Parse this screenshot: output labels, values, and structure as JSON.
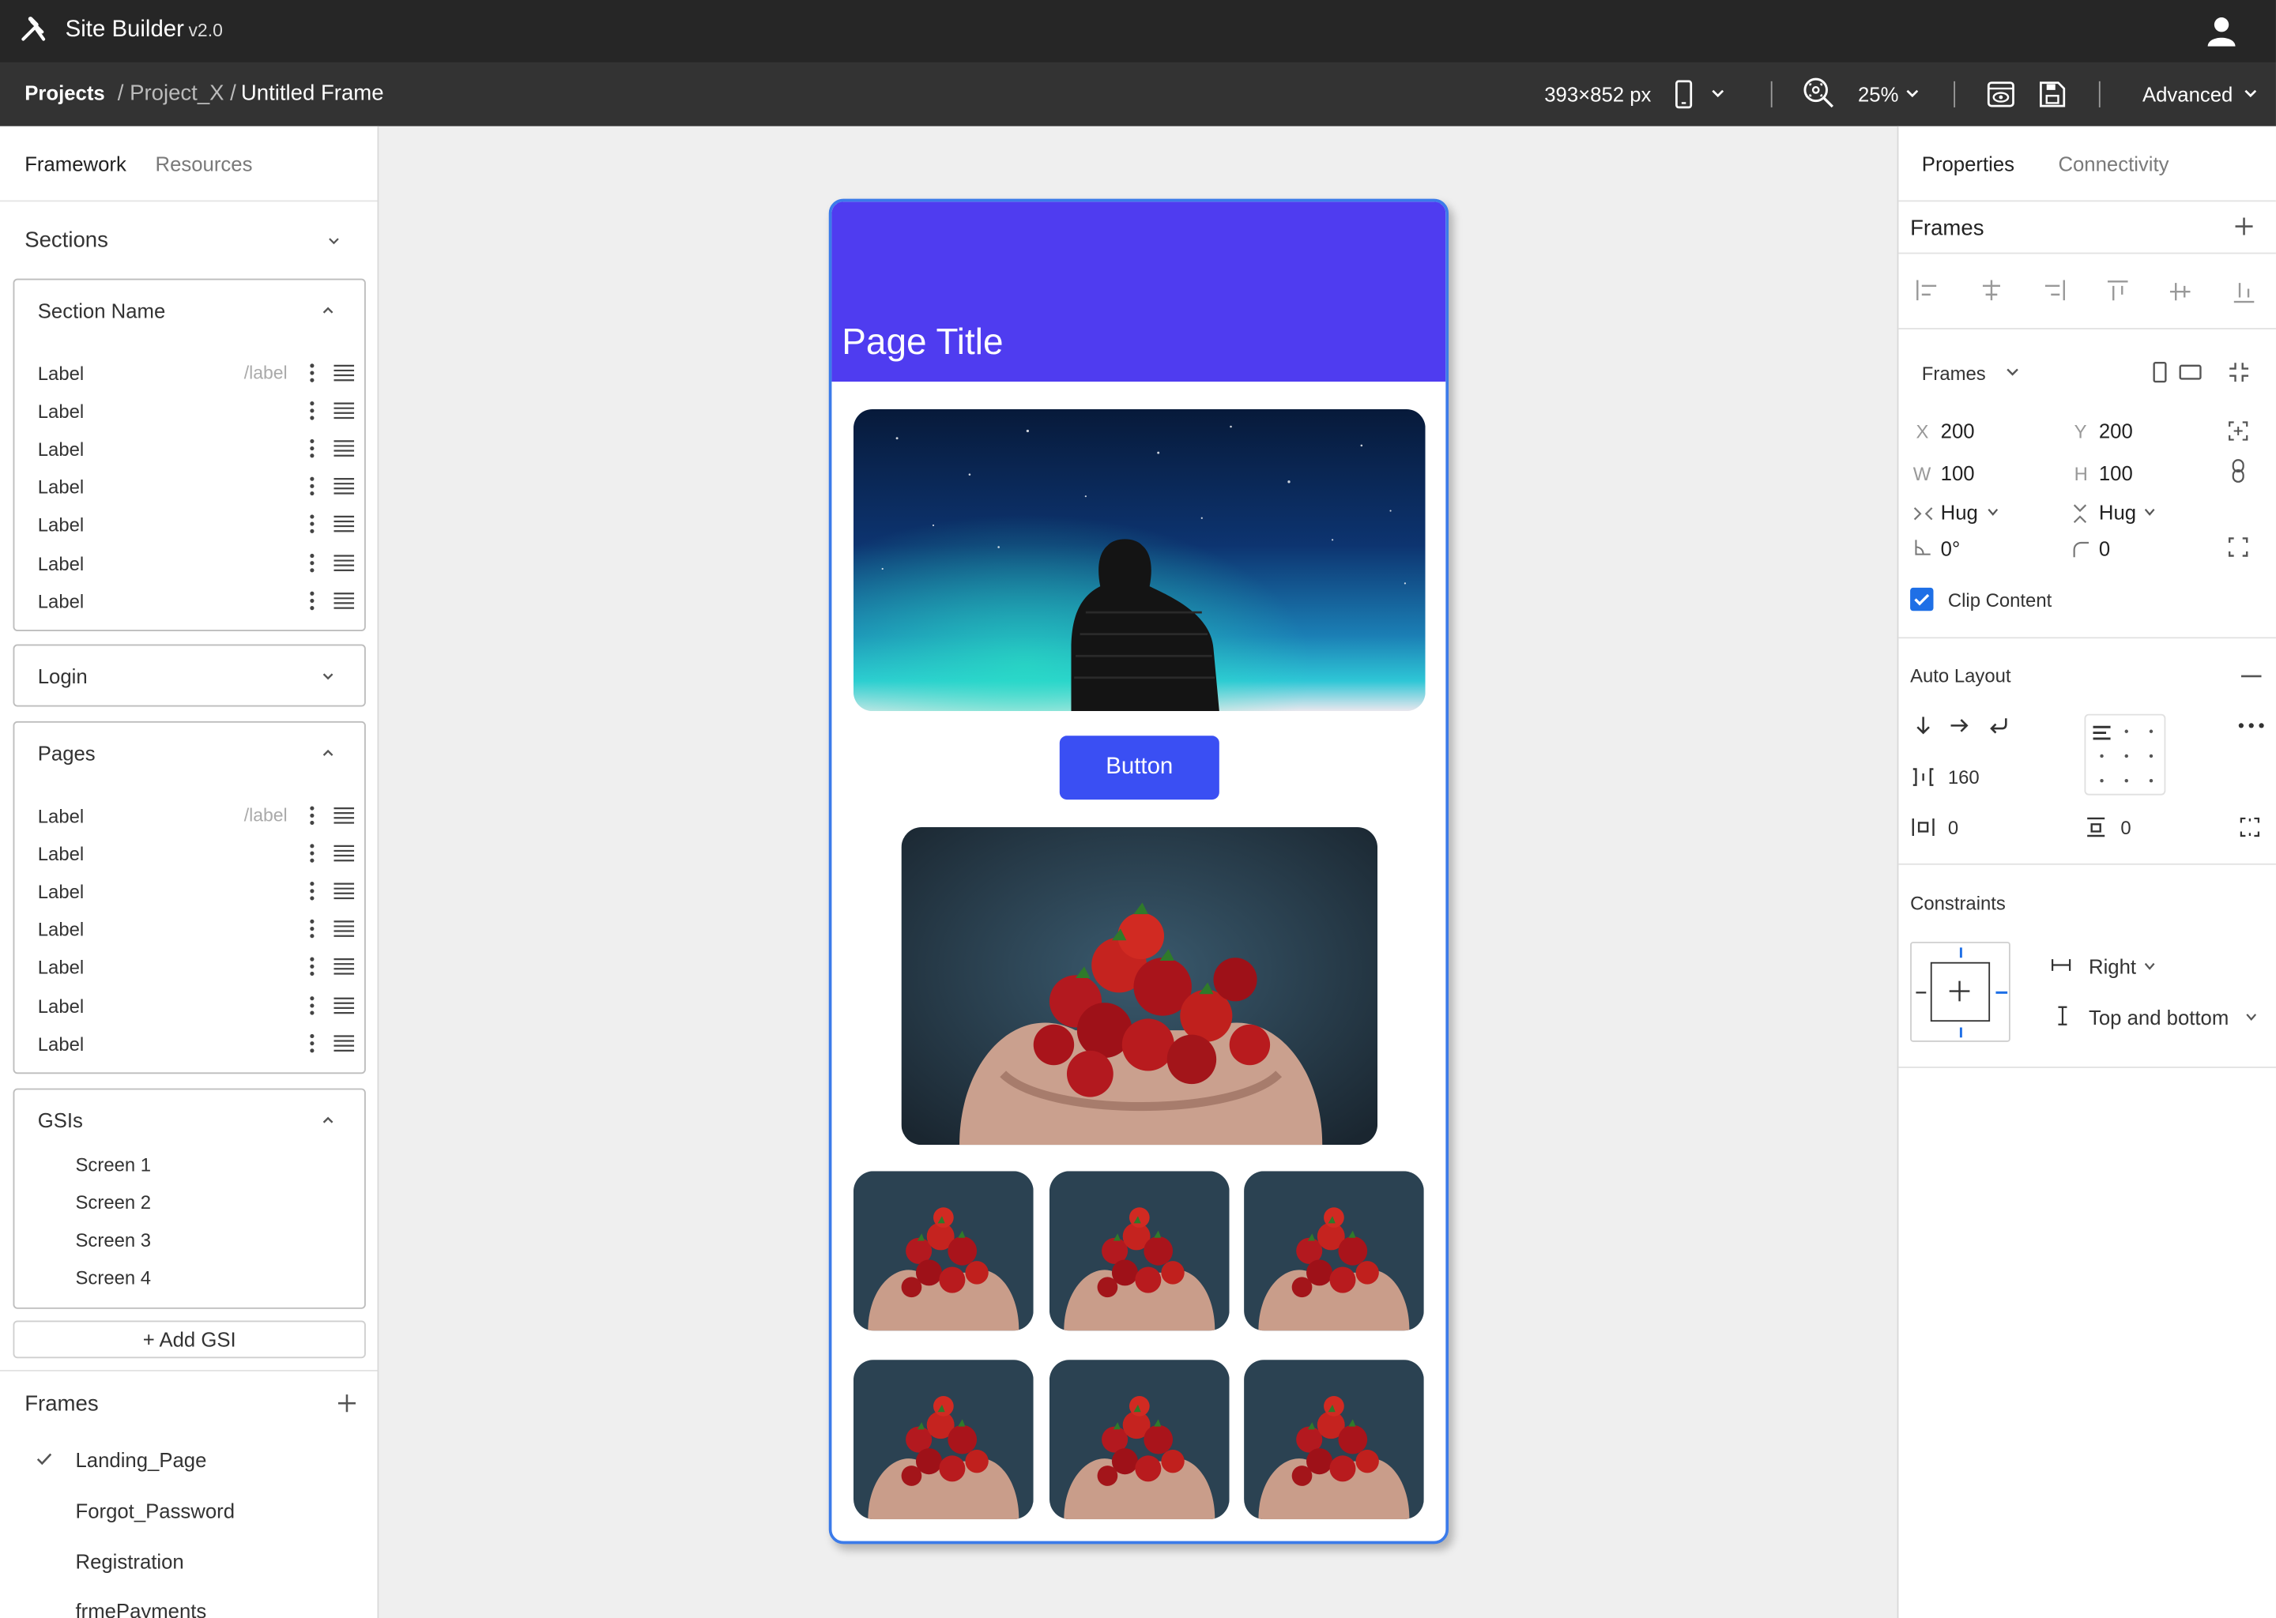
{
  "app": {
    "title": "Site Builder",
    "version": "v2.0"
  },
  "toolbar": {
    "breadcrumb_projects": "Projects",
    "breadcrumb_project": "/ Project_X /",
    "breadcrumb_frame": "Untitled Frame",
    "frame_size": "393×852 px",
    "zoom": "25%",
    "advanced": "Advanced"
  },
  "left_panel": {
    "tabs": [
      "Framework",
      "Resources"
    ],
    "sections_header": "Sections",
    "section_card": {
      "title": "Section Name",
      "rows": [
        {
          "label": "Label",
          "path": "/label"
        },
        {
          "label": "Label",
          "path": ""
        },
        {
          "label": "Label",
          "path": ""
        },
        {
          "label": "Label",
          "path": ""
        },
        {
          "label": "Label",
          "path": ""
        },
        {
          "label": "Label",
          "path": ""
        },
        {
          "label": "Label",
          "path": ""
        }
      ]
    },
    "login_card": {
      "title": "Login"
    },
    "pages_card": {
      "title": "Pages",
      "rows": [
        {
          "label": "Label",
          "path": "/label"
        },
        {
          "label": "Label",
          "path": ""
        },
        {
          "label": "Label",
          "path": ""
        },
        {
          "label": "Label",
          "path": ""
        },
        {
          "label": "Label",
          "path": ""
        },
        {
          "label": "Label",
          "path": ""
        },
        {
          "label": "Label",
          "path": ""
        }
      ]
    },
    "gsis_card": {
      "title": "GSIs",
      "items": [
        "Screen 1",
        "Screen 2",
        "Screen 3",
        "Screen 4"
      ]
    },
    "add_gsi": "+ Add GSI",
    "frames_header": "Frames",
    "frames": [
      "Landing_Page",
      "Forgot_Password",
      "Registration",
      "frmePayments"
    ],
    "selected_frame": "Landing_Page"
  },
  "canvas": {
    "page_title": "Page Title",
    "button_label": "Button",
    "header_color": "#4f3cf0",
    "button_color": "#3a4ff3"
  },
  "right_panel": {
    "tabs": [
      "Properties",
      "Connectivity"
    ],
    "frames_header": "Frames",
    "frames_select": "Frames",
    "x_label": "X",
    "x_value": "200",
    "y_label": "Y",
    "y_value": "200",
    "w_label": "W",
    "w_value": "100",
    "h_label": "H",
    "h_value": "100",
    "hug_h": "Hug",
    "hug_v": "Hug",
    "rotation": "0°",
    "radius": "0",
    "clip_content": "Clip Content",
    "auto_layout": "Auto Layout",
    "spacing": "160",
    "padding_h": "0",
    "padding_v": "0",
    "constraints": "Constraints",
    "constraint_h": "Right",
    "constraint_v": "Top and bottom"
  }
}
